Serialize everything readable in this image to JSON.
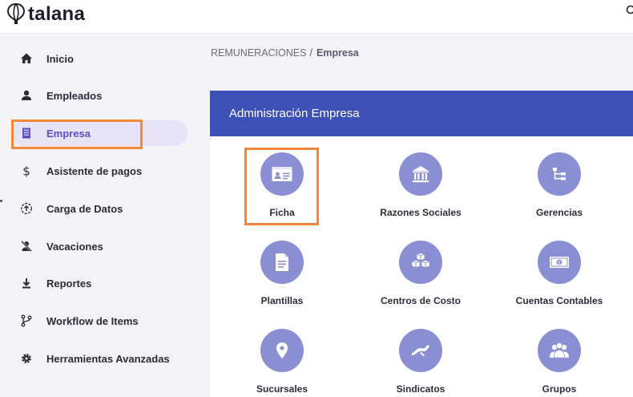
{
  "app": {
    "brand": "talana"
  },
  "sidebar": {
    "items": [
      {
        "label": "Inicio",
        "icon": "home-icon",
        "active": false
      },
      {
        "label": "Empleados",
        "icon": "person-icon",
        "active": false
      },
      {
        "label": "Empresa",
        "icon": "building-icon",
        "active": true
      },
      {
        "label": "Asistente de pagos",
        "icon": "dollar-icon",
        "active": false
      },
      {
        "label": "Carga de Datos",
        "icon": "upload-circle-icon",
        "active": false
      },
      {
        "label": "Vacaciones",
        "icon": "person-off-icon",
        "active": false
      },
      {
        "label": "Reportes",
        "icon": "download-icon",
        "active": false
      },
      {
        "label": "Workflow de Items",
        "icon": "workflow-icon",
        "active": false
      },
      {
        "label": "Herramientas Avanzadas",
        "icon": "gear-icon",
        "active": false
      }
    ]
  },
  "breadcrumb": {
    "parent": "REMUNERACIONES",
    "separator": "/",
    "current": "Empresa"
  },
  "panel": {
    "title": "Administración Empresa",
    "tiles": [
      {
        "label": "Ficha",
        "icon": "id-card-icon"
      },
      {
        "label": "Razones Sociales",
        "icon": "bank-icon"
      },
      {
        "label": "Gerencias",
        "icon": "hierarchy-icon"
      },
      {
        "label": "Plantillas",
        "icon": "document-icon"
      },
      {
        "label": "Centros de Costo",
        "icon": "cubes-icon"
      },
      {
        "label": "Cuentas Contables",
        "icon": "money-bill-icon"
      },
      {
        "label": "Sucursales",
        "icon": "map-pin-icon"
      },
      {
        "label": "Sindicatos",
        "icon": "handshake-icon"
      },
      {
        "label": "Grupos",
        "icon": "group-icon"
      }
    ]
  },
  "colors": {
    "accent": "#5b4ec7",
    "header_bar": "#3d50b5",
    "tile_circle": "#8a8fd3",
    "highlight": "#f5873a",
    "sidebar_bg": "#f3f3f8"
  }
}
